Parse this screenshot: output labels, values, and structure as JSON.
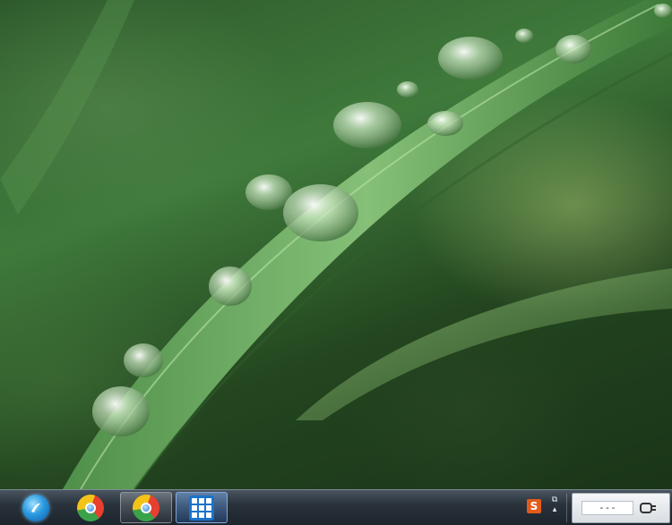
{
  "desktop": {
    "wallpaper": "grass-blade-with-water-droplets"
  },
  "taskbar": {
    "start_button": {
      "icon": "start-orb-icon"
    },
    "items": [
      {
        "name": "browser-pinned",
        "icon": "browser-icon",
        "state": "pinned"
      },
      {
        "name": "browser-open",
        "icon": "browser-icon",
        "state": "open"
      },
      {
        "name": "app-open",
        "icon": "app-tiles-icon",
        "state": "active"
      }
    ],
    "tray": {
      "ime_label": "S",
      "expand_icon": "tray-expand-icon",
      "clock_text": "---",
      "power_icon": "power-plug-icon"
    }
  },
  "colors": {
    "taskbar": "#1c242c",
    "start_orb": "#2a9ae0",
    "ime": "#e25b1b",
    "app_tile": "#1a73c9"
  }
}
